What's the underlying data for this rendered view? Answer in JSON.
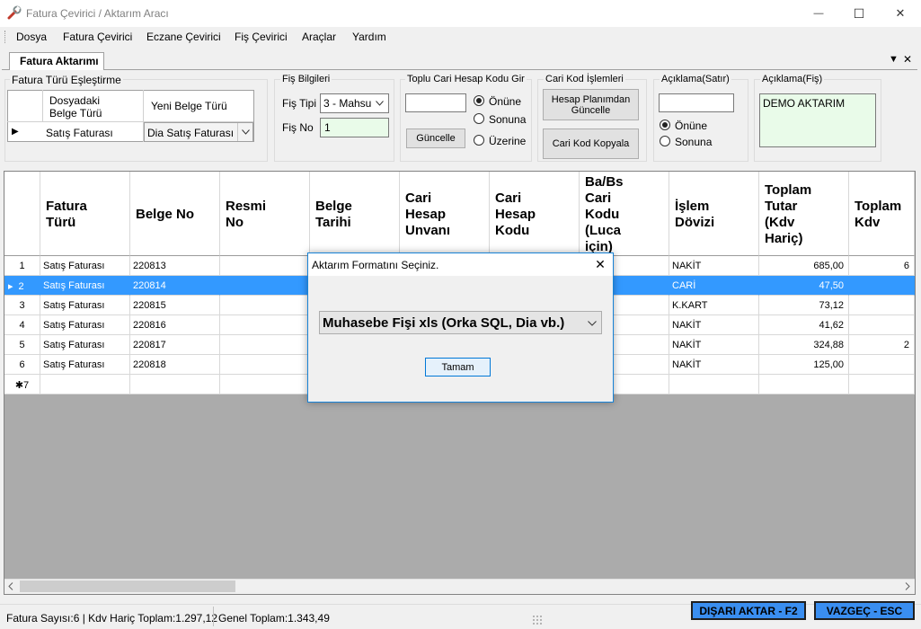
{
  "window": {
    "title": "Fatura Çevirici / Aktarım Aracı",
    "minimize_glyph": "—",
    "maximize_glyph": "☐",
    "close_glyph": "✕"
  },
  "menu": {
    "items": [
      "Dosya",
      "Fatura Çevirici",
      "Eczane Çevirici",
      "Fiş Çevirici",
      "Araçlar",
      "Yardım"
    ]
  },
  "tab": {
    "label": "Fatura Aktarımı",
    "dropdown_glyph": "▼",
    "close_glyph": "✕"
  },
  "mapping": {
    "group_label": "Fatura  Türü Eşleştirme",
    "col_source": "Dosyadaki\nBelge Türü",
    "col_target": "Yeni Belge Türü",
    "row_indicator": "▶",
    "source_value": "Satış Faturası",
    "target_value": "Dia Satış Faturası"
  },
  "fis_bilgileri": {
    "group_label": "Fiş Bilgileri",
    "fis_tipi_label": "Fiş Tipi",
    "fis_tipi_value": "3 - Mahsu",
    "fis_no_label": "Fiş No",
    "fis_no_value": "1"
  },
  "toplu_cari": {
    "group_label": "Toplu Cari Hesap Kodu Gir",
    "input_value": "",
    "guncelle_label": "Güncelle",
    "options": [
      "Önüne",
      "Sonuna",
      "Üzerine"
    ],
    "selected": "Önüne"
  },
  "cari_kod": {
    "group_label": "Cari Kod İşlemleri",
    "hesap_plani_label": "Hesap Planımdan\nGüncelle",
    "kopyala_label": "Cari Kod Kopyala"
  },
  "aciklama_satir": {
    "group_label": "Açıklama(Satır)",
    "input_value": "",
    "options": [
      "Önüne",
      "Sonuna"
    ],
    "selected": "Önüne"
  },
  "aciklama_fis": {
    "group_label": "Açıklama(Fiş)",
    "value": "DEMO AKTARIM"
  },
  "grid": {
    "columns": [
      "Fatura\nTürü",
      "Belge No",
      "Resmi\nNo",
      "Belge\nTarihi",
      "Cari\nHesap\nUnvanı",
      "Cari\nHesap\nKodu",
      "Ba/Bs\nCari\nKodu\n(Luca\niçin)",
      "İşlem\nDövizi",
      "Toplam\nTutar\n(Kdv\nHariç)",
      "Toplam\nKdv"
    ],
    "rows": [
      {
        "num": "1",
        "fatura_turu": "Satış Faturası",
        "belge_no": "220813",
        "doviz": "NAKİT",
        "tutar": "685,00",
        "kdv": "6"
      },
      {
        "num": "2",
        "fatura_turu": "Satış Faturası",
        "belge_no": "220814",
        "doviz": "CARİ",
        "tutar": "47,50",
        "kdv": ""
      },
      {
        "num": "3",
        "fatura_turu": "Satış Faturası",
        "belge_no": "220815",
        "doviz": "K.KART",
        "tutar": "73,12",
        "kdv": ""
      },
      {
        "num": "4",
        "fatura_turu": "Satış Faturası",
        "belge_no": "220816",
        "doviz": "NAKİT",
        "tutar": "41,62",
        "kdv": ""
      },
      {
        "num": "5",
        "fatura_turu": "Satış Faturası",
        "belge_no": "220817",
        "doviz": "NAKİT",
        "tutar": "324,88",
        "kdv": "2"
      },
      {
        "num": "6",
        "fatura_turu": "Satış Faturası",
        "belge_no": "220818",
        "doviz": "NAKİT",
        "tutar": "125,00",
        "kdv": ""
      }
    ],
    "selected_row": 2,
    "new_row_label": "✱7"
  },
  "dialog": {
    "title": "Aktarım Formatını Seçiniz.",
    "close_glyph": "✕",
    "format_value": "Muhasebe Fişi xls (Orka SQL, Dia vb.)",
    "ok_label": "Tamam"
  },
  "status": {
    "summary": "Fatura Sayısı:6 | Kdv Hariç Toplam:1.297,12",
    "genel_toplam": "Genel Toplam:1.343,49",
    "export_label": "DIŞARI AKTAR - F2",
    "cancel_label": "VAZGEÇ - ESC"
  }
}
